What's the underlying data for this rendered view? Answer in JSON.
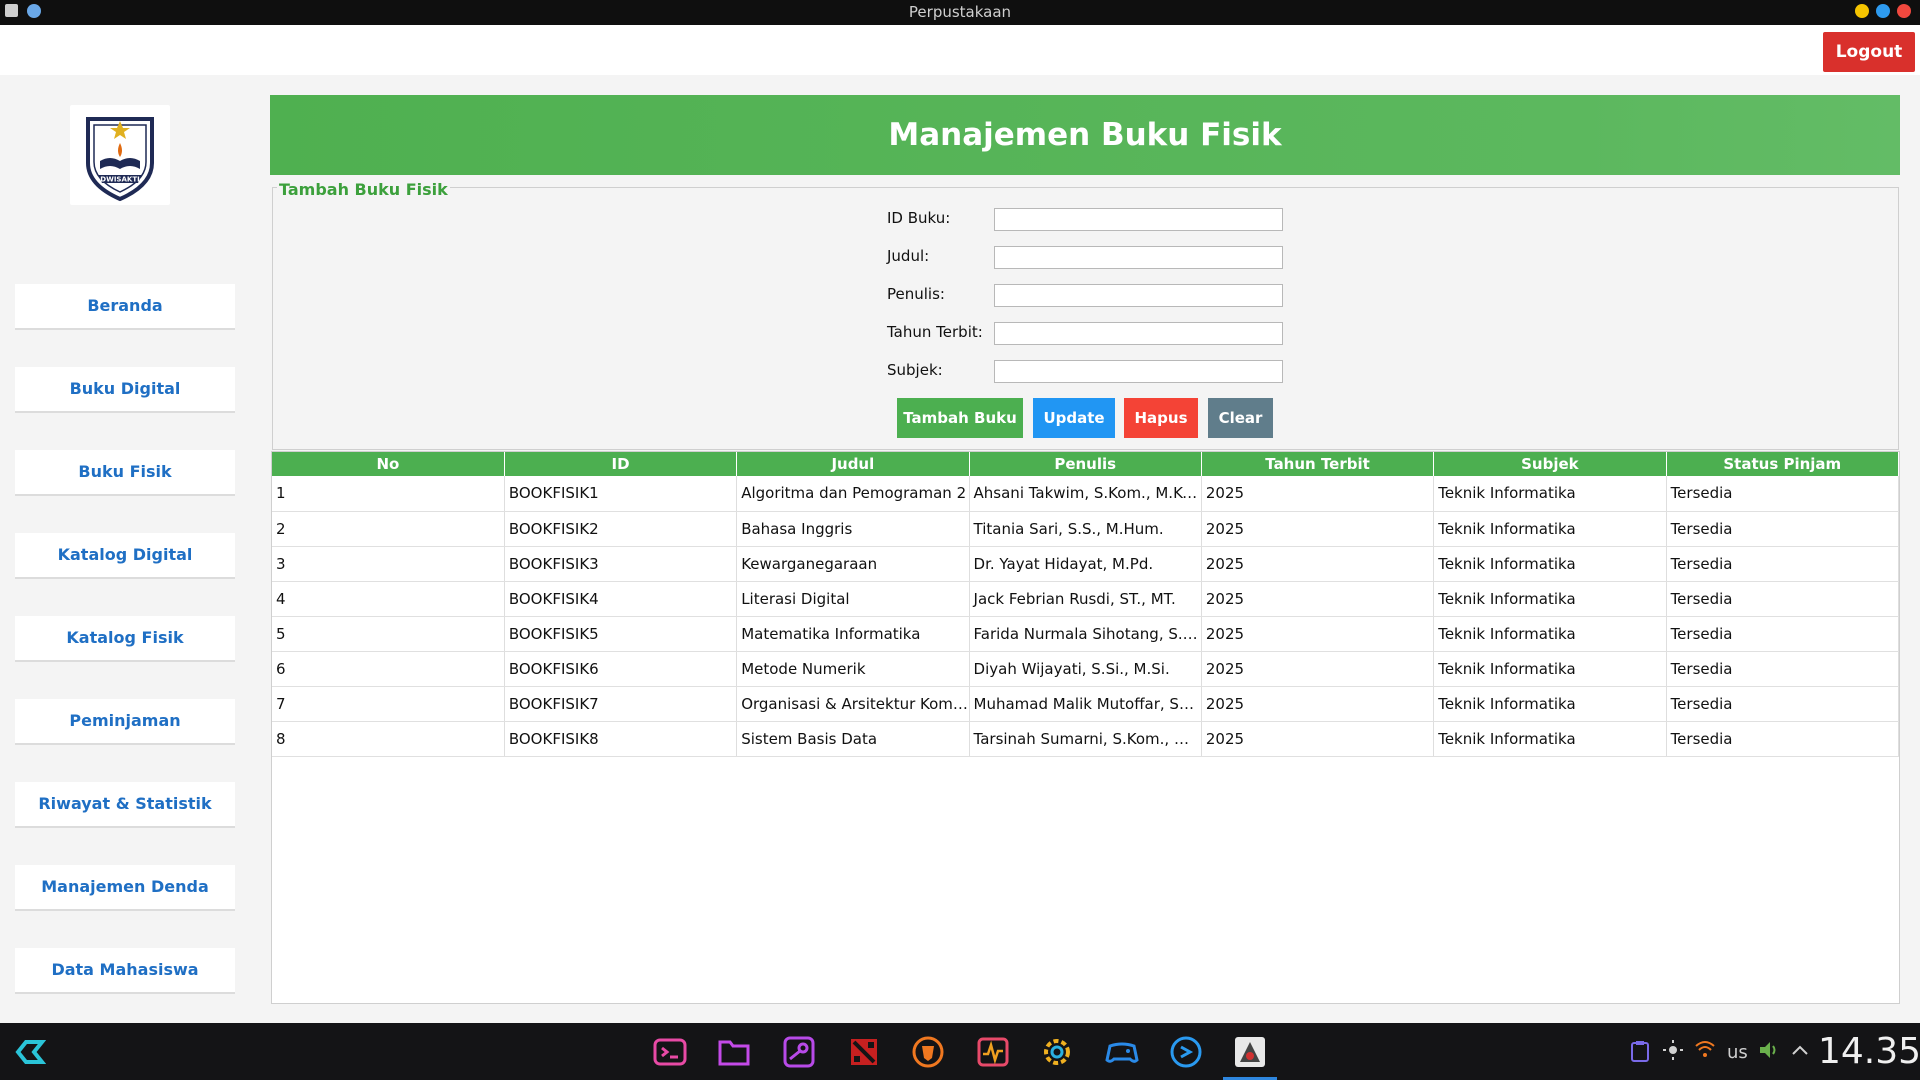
{
  "window": {
    "title": "Perpustakaan"
  },
  "topbar": {
    "logout_label": "Logout"
  },
  "sidebar": {
    "logo_text": "DWISAKTI",
    "items": [
      {
        "label": "Beranda"
      },
      {
        "label": "Buku Digital"
      },
      {
        "label": "Buku Fisik"
      },
      {
        "label": "Katalog Digital"
      },
      {
        "label": "Katalog Fisik"
      },
      {
        "label": "Peminjaman"
      },
      {
        "label": "Riwayat & Statistik"
      },
      {
        "label": "Manajemen Denda"
      },
      {
        "label": "Data Mahasiswa"
      }
    ]
  },
  "main": {
    "title": "Manajemen Buku Fisik",
    "form": {
      "legend": "Tambah Buku Fisik",
      "fields": [
        {
          "label": "ID Buku:",
          "value": ""
        },
        {
          "label": "Judul:",
          "value": ""
        },
        {
          "label": "Penulis:",
          "value": ""
        },
        {
          "label": "Tahun Terbit:",
          "value": ""
        },
        {
          "label": "Subjek:",
          "value": ""
        }
      ],
      "buttons": {
        "add": "Tambah Buku",
        "update": "Update",
        "delete": "Hapus",
        "clear": "Clear"
      }
    },
    "table": {
      "columns": [
        "No",
        "ID",
        "Judul",
        "Penulis",
        "Tahun Terbit",
        "Subjek",
        "Status Pinjam"
      ],
      "rows": [
        [
          "1",
          "BOOKFISIK1",
          "Algoritma dan Pemograman 2",
          "Ahsani Takwim, S.Kom., M.Kom",
          "2025",
          "Teknik Informatika",
          "Tersedia"
        ],
        [
          "2",
          "BOOKFISIK2",
          "Bahasa Inggris",
          "Titania Sari, S.S., M.Hum.",
          "2025",
          "Teknik Informatika",
          "Tersedia"
        ],
        [
          "3",
          "BOOKFISIK3",
          "Kewarganegaraan",
          "Dr. Yayat Hidayat, M.Pd.",
          "2025",
          "Teknik Informatika",
          "Tersedia"
        ],
        [
          "4",
          "BOOKFISIK4",
          "Literasi Digital",
          "Jack Febrian Rusdi, ST., MT.",
          "2025",
          "Teknik Informatika",
          "Tersedia"
        ],
        [
          "5",
          "BOOKFISIK5",
          "Matematika Informatika",
          "Farida Nurmala Sihotang, S.Si., ...",
          "2025",
          "Teknik Informatika",
          "Tersedia"
        ],
        [
          "6",
          "BOOKFISIK6",
          "Metode Numerik",
          "Diyah Wijayati, S.Si., M.Si.",
          "2025",
          "Teknik Informatika",
          "Tersedia"
        ],
        [
          "7",
          "BOOKFISIK7",
          "Organisasi & Arsitektur Komput...",
          "Muhamad Malik Mutoffar, ST., ...",
          "2025",
          "Teknik Informatika",
          "Tersedia"
        ],
        [
          "8",
          "BOOKFISIK8",
          "Sistem Basis Data",
          "Tarsinah Sumarni, S.Kom., M.K...",
          "2025",
          "Teknik Informatika",
          "Tersedia"
        ]
      ]
    }
  },
  "taskbar": {
    "apps": [
      {
        "icon": "terminal-icon"
      },
      {
        "icon": "folder-icon"
      },
      {
        "icon": "steam-icon"
      },
      {
        "icon": "dota-icon"
      },
      {
        "icon": "brave-icon"
      },
      {
        "icon": "system-monitor-icon"
      },
      {
        "icon": "settings-icon"
      },
      {
        "icon": "gamepad-icon"
      },
      {
        "icon": "vscode-icon"
      },
      {
        "icon": "java-app-icon"
      }
    ],
    "keyboard_layout": "us",
    "clock": "14.35"
  }
}
